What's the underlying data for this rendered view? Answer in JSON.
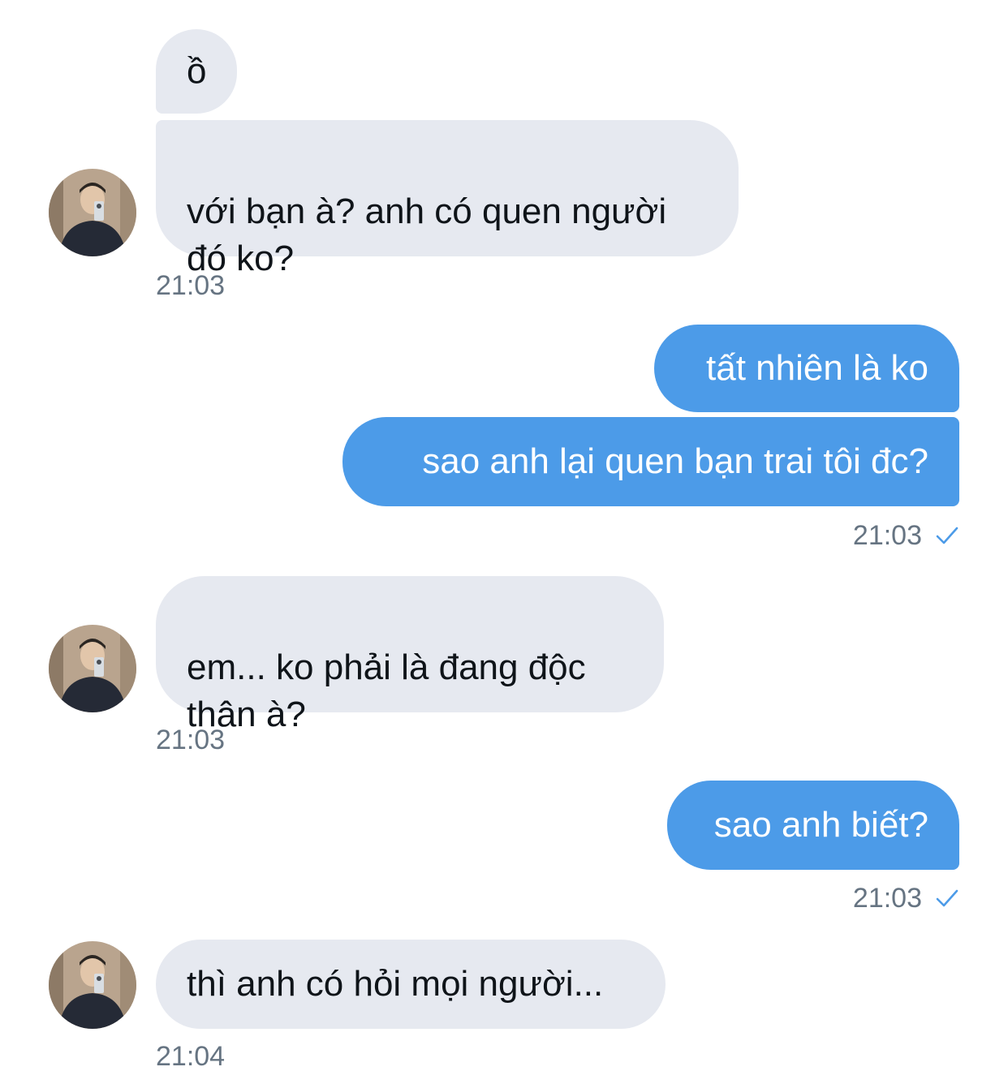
{
  "messages": [
    {
      "side": "in",
      "text": "ồ"
    },
    {
      "side": "in",
      "text": "với bạn à? anh có quen người\nđó ko?",
      "time": "21:03"
    },
    {
      "side": "out",
      "text": "tất nhiên là ko"
    },
    {
      "side": "out",
      "text": "sao anh lại quen bạn trai tôi đc?",
      "time": "21:03",
      "read": "check-icon"
    },
    {
      "side": "in",
      "text": "em... ko phải là đang độc\nthân à?",
      "time": "21:03"
    },
    {
      "side": "out",
      "text": "sao anh biết?",
      "time": "21:03",
      "read": "check-icon"
    },
    {
      "side": "in",
      "text": "thì anh có hỏi mọi người...",
      "time": "21:04"
    }
  ],
  "colors": {
    "incoming_bubble": "#e6e9f0",
    "outgoing_bubble": "#4c9be8",
    "timestamp": "#667482",
    "read_check": "#4c9be8"
  }
}
